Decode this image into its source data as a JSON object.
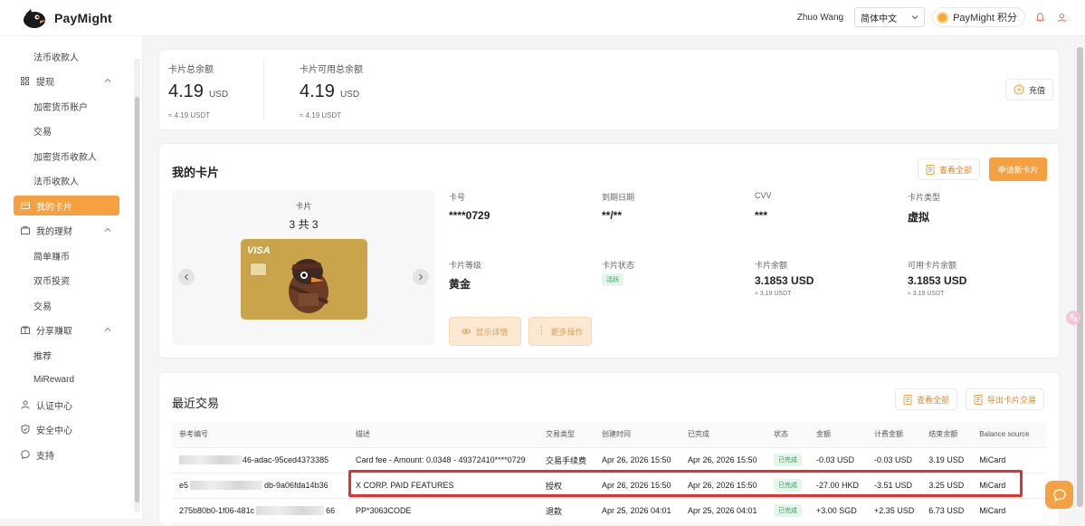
{
  "brand": {
    "name": "PayMight"
  },
  "topbar": {
    "user": "Zhuo Wang",
    "language": "简体中文",
    "points_label": "PayMight 积分"
  },
  "sidebar": {
    "items": [
      {
        "label": "法币收款人"
      },
      {
        "label": "提现"
      },
      {
        "label": "加密货币账户"
      },
      {
        "label": "交易"
      },
      {
        "label": "加密货币收款人"
      },
      {
        "label": "法币收款人"
      },
      {
        "label": "我的卡片"
      },
      {
        "label": "我的理财"
      },
      {
        "label": "简单赚币"
      },
      {
        "label": "双币投资"
      },
      {
        "label": "交易"
      },
      {
        "label": "分享赚取"
      },
      {
        "label": "推荐"
      },
      {
        "label": "MiReward"
      },
      {
        "label": "认证中心"
      },
      {
        "label": "安全中心"
      },
      {
        "label": "支持"
      }
    ]
  },
  "balance": {
    "total_label": "卡片总余额",
    "total_value": "4.19",
    "total_unit": "USD",
    "total_sub": "≈ 4.19 USDT",
    "available_label": "卡片可用总余额",
    "available_value": "4.19",
    "available_unit": "USD",
    "available_sub": "≈ 4.19 USDT",
    "topup_label": "充值"
  },
  "my_cards": {
    "title": "我的卡片",
    "view_all": "查看全部",
    "apply": "申请新卡片",
    "carousel_label": "卡片",
    "carousel_count": "3 共 3",
    "visa": "VISA",
    "fields": [
      {
        "label": "卡号",
        "value": "****0729"
      },
      {
        "label": "到期日期",
        "value": "**/**"
      },
      {
        "label": "CVV",
        "value": "***"
      },
      {
        "label": "卡片类型",
        "value": "虚拟"
      },
      {
        "label": "卡片等级",
        "value": "黄金"
      },
      {
        "label": "卡片状态",
        "value": "活跃"
      },
      {
        "label": "卡片余额",
        "value": "3.1853 USD",
        "sub": "≈ 3.19 USDT"
      },
      {
        "label": "可用卡片余额",
        "value": "3.1853 USD",
        "sub": "≈ 3.19 USDT"
      }
    ],
    "show_details": "显示详情",
    "more_actions": "更多操作"
  },
  "recent": {
    "title": "最近交易",
    "view_all": "查看全部",
    "export": "导出卡片交易",
    "columns": [
      "参考编号",
      "描述",
      "交易类型",
      "创建时间",
      "已完成",
      "状态",
      "金额",
      "计费金额",
      "结束余额",
      "Balance source"
    ],
    "rows": [
      {
        "ref": "46-adac-95ced4373385",
        "desc": "Card fee - Amount: 0.0348 - 49372410****0729",
        "type": "交易手续费",
        "created": "Apr 26, 2026 15:50",
        "done": "Apr 26, 2026 15:50",
        "status": "已完成",
        "amount": "-0.03 USD",
        "billed": "-0.03 USD",
        "end": "3.19 USD",
        "source": "MiCard"
      },
      {
        "ref": "db-9a06fda14b36",
        "desc": "X CORP. PAID FEATURES",
        "type": "授权",
        "created": "Apr 26, 2026 15:50",
        "done": "Apr 26, 2026 15:50",
        "status": "已完成",
        "amount": "-27.00 HKD",
        "billed": "-3.51 USD",
        "end": "3.25 USD",
        "source": "MiCard"
      },
      {
        "ref": "66",
        "desc": "PP*3063CODE",
        "type": "退款",
        "created": "Apr 25, 2026 04:01",
        "done": "Apr 25, 2026 04:01",
        "status": "已完成",
        "amount": "+3.00 SGD",
        "billed": "+2.35 USD",
        "end": "6.73 USD",
        "source": "MiCard"
      }
    ],
    "ref_prefix": [
      "",
      "e5",
      "275b80b0-1f06-481c"
    ]
  },
  "colors": {
    "accent": "#f5a142",
    "highlight": "#e0332f",
    "success": "#2aa458"
  }
}
